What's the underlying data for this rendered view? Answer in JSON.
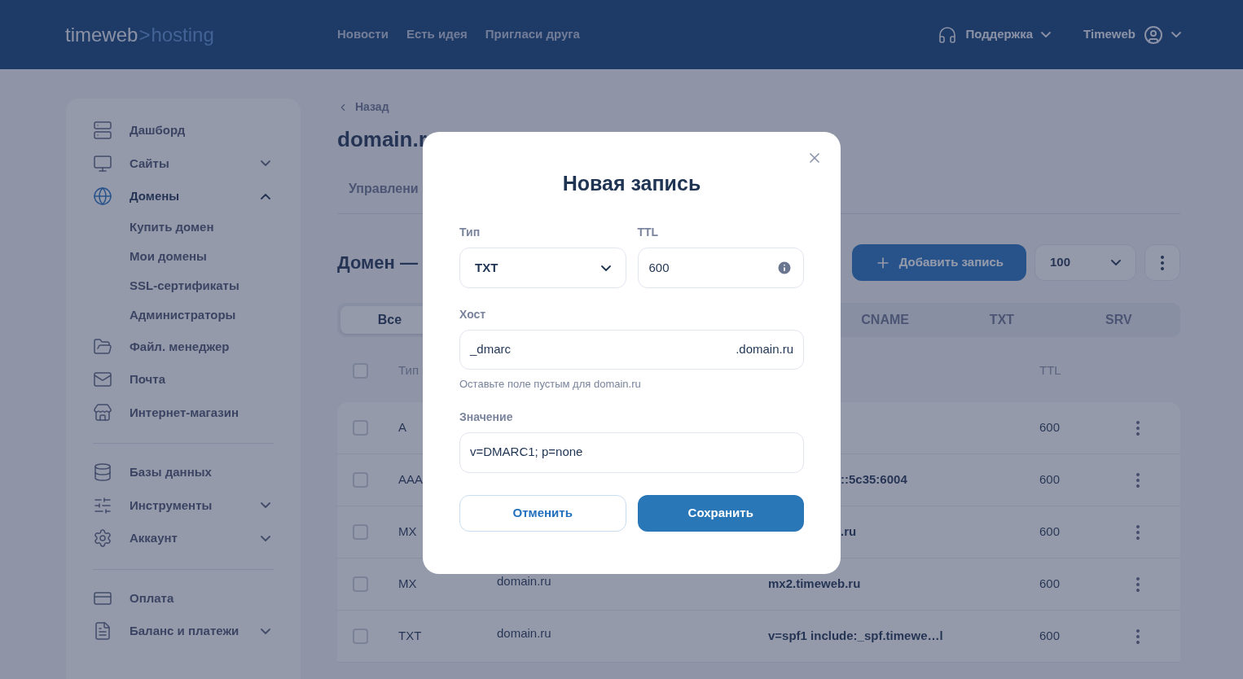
{
  "header": {
    "logo": {
      "brand": "timeweb",
      "separator": ">",
      "product": "hosting"
    },
    "nav": [
      "Новости",
      "Есть идея",
      "Пригласи друга"
    ],
    "support": "Поддержка",
    "account": "Timeweb"
  },
  "sidebar": {
    "groups": [
      {
        "items": [
          {
            "label": "Дашборд",
            "active": false
          },
          {
            "label": "Сайты",
            "active": false,
            "expanded": false
          },
          {
            "label": "Домены",
            "active": true,
            "expanded": true,
            "children": [
              {
                "label": "Купить домен"
              },
              {
                "label": "Мои домены"
              },
              {
                "label": "SSL-сертификаты"
              },
              {
                "label": "Администраторы"
              }
            ]
          },
          {
            "label": "Файл. менеджер",
            "active": false
          },
          {
            "label": "Почта",
            "active": false
          },
          {
            "label": "Интернет-магазин",
            "active": false
          }
        ]
      },
      {
        "items": [
          {
            "label": "Базы данных",
            "active": false
          },
          {
            "label": "Инструменты",
            "active": false,
            "expanded": false
          },
          {
            "label": "Аккаунт",
            "active": false,
            "expanded": false
          }
        ]
      },
      {
        "items": [
          {
            "label": "Оплата",
            "active": false
          },
          {
            "label": "Баланс и платежи",
            "active": false,
            "expanded": false
          }
        ]
      }
    ]
  },
  "main": {
    "back": "Назад",
    "title": "domain.r",
    "tab": "Управлени",
    "section_title": "Домен —",
    "add_button": "Добавить запись",
    "page_size": "100",
    "filters": [
      {
        "label": "Все",
        "selected": true
      },
      {
        "label": "CNAME",
        "selected": false
      },
      {
        "label": "TXT",
        "selected": false
      },
      {
        "label": "SRV",
        "selected": false
      }
    ],
    "columns": {
      "select_all_checked": false,
      "type": "Тип",
      "ttl": "TTL"
    },
    "rows": [
      {
        "checked": false,
        "type": "A",
        "ttl": "600"
      },
      {
        "checked": false,
        "type": "AAA",
        "value": "::5c35:6004",
        "value_partial": true,
        "ttl": "600"
      },
      {
        "checked": false,
        "type": "MX",
        "value": ".ru",
        "value_partial": true,
        "ttl": "600"
      },
      {
        "checked": false,
        "type": "MX",
        "host": "domain.ru",
        "value": "mx2.timeweb.ru",
        "value_partial": false,
        "ttl": "600"
      },
      {
        "checked": false,
        "type": "TXT",
        "host": "domain.ru",
        "value": "v=spf1 include:_spf.timewe…l",
        "value_partial": false,
        "ttl": "600"
      }
    ]
  },
  "dialog": {
    "title": "Новая запись",
    "type_label": "Тип",
    "type_value": "TXT",
    "ttl_label": "TTL",
    "ttl_value": "600",
    "host_label": "Хост",
    "host_value": "_dmarc",
    "host_suffix": ".domain.ru",
    "host_hint": "Оставьте поле пустым для domain.ru",
    "value_label": "Значение",
    "value_value": "v=DMARC1; p=none",
    "cancel": "Отменить",
    "save": "Сохранить"
  }
}
